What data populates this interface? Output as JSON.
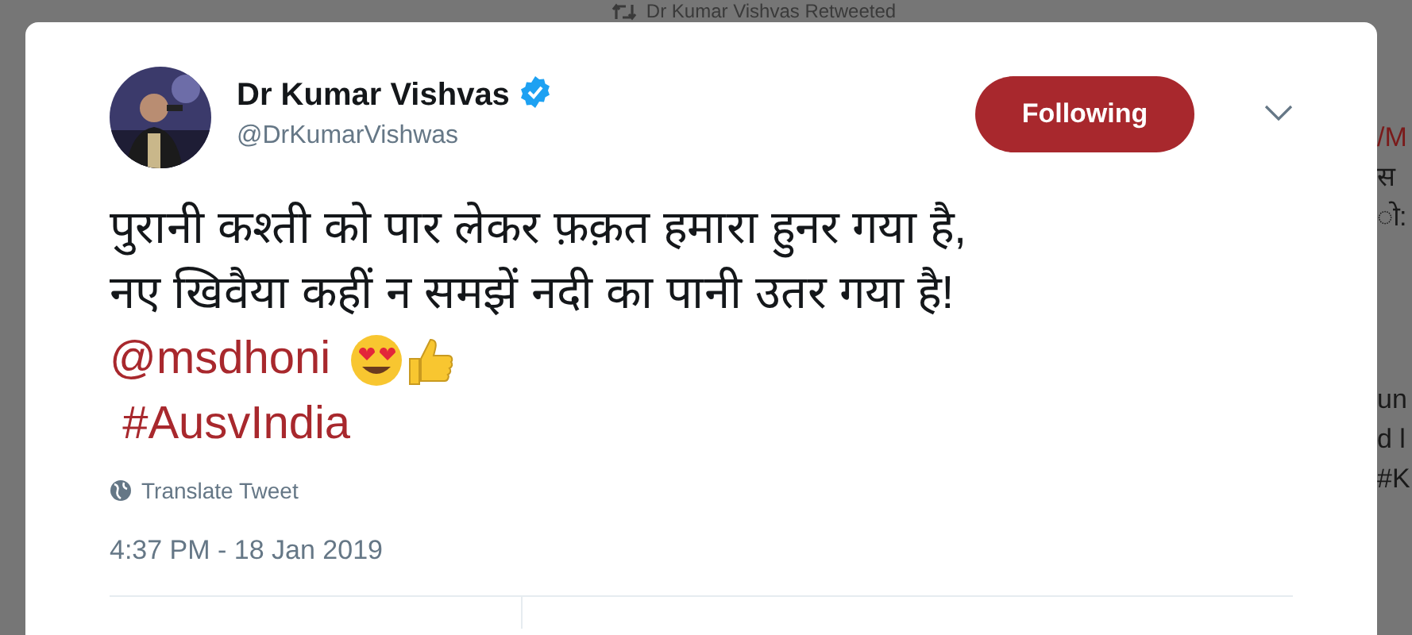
{
  "background": {
    "retweet_note": "Dr Kumar Vishvas Retweeted",
    "side_fragments": [
      {
        "text": "/M",
        "kind": "link"
      },
      {
        "text": "स",
        "kind": "text"
      },
      {
        "text": "ो:",
        "kind": "text"
      },
      {
        "text": "un",
        "kind": "text"
      },
      {
        "text": "d l",
        "kind": "text"
      },
      {
        "text": "#K",
        "kind": "text"
      }
    ]
  },
  "tweet": {
    "author": {
      "name": "Dr Kumar Vishvas",
      "verified": true,
      "handle": "@DrKumarVishwas"
    },
    "follow_button": {
      "label": "Following",
      "following": true
    },
    "text_lines": [
      "पुरानी कश्ती को पार लेकर फ़क़त हमारा हुनर गया है,",
      "नए खिवैया कहीं न समझें नदी का पानी उतर गया है!"
    ],
    "mention": "@msdhoni",
    "hashtag": "#AusvIndia",
    "translate": "Translate Tweet",
    "timestamp": "4:37 PM - 18 Jan 2019"
  }
}
